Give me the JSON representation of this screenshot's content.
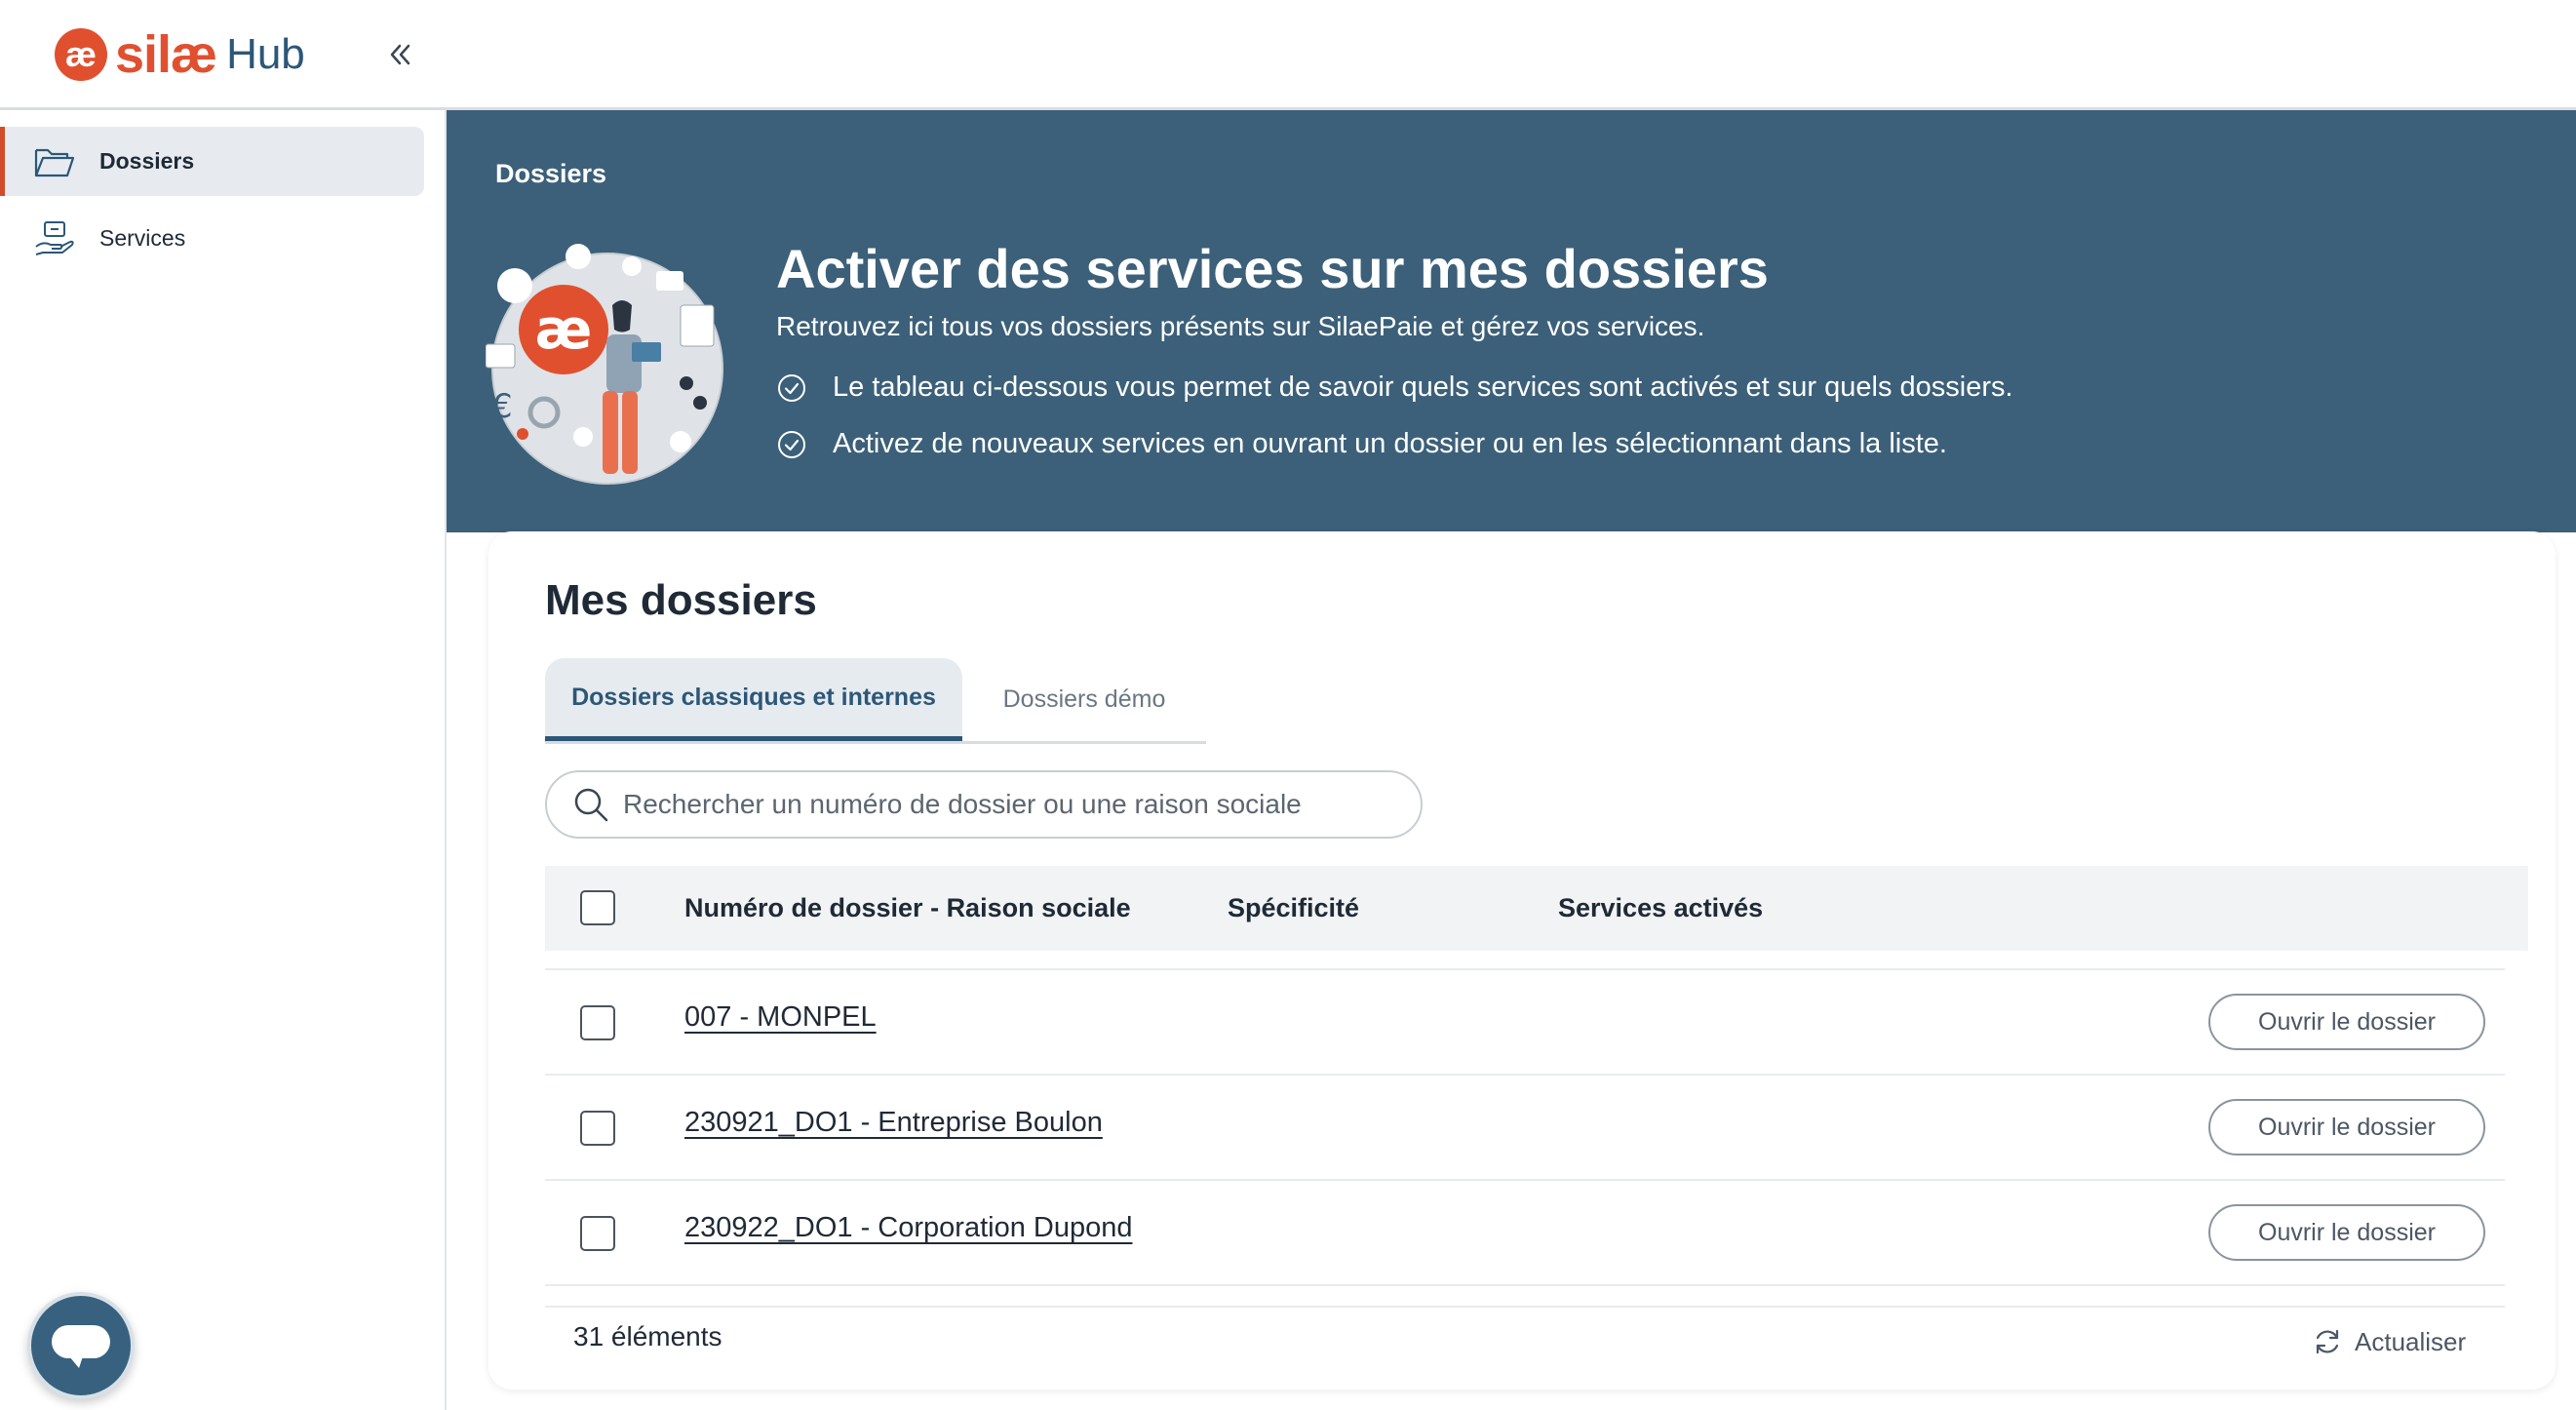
{
  "app": {
    "brand": "silæ",
    "product": "Hub",
    "logo_mark": "æ"
  },
  "sidebar": {
    "items": [
      {
        "label": "Dossiers",
        "icon": "folder-open-icon",
        "active": true
      },
      {
        "label": "Services",
        "icon": "hand-service-icon",
        "active": false
      }
    ]
  },
  "hero": {
    "breadcrumb": "Dossiers",
    "title": "Activer des services sur mes dossiers",
    "subtitle": "Retrouvez ici tous vos dossiers présents sur SilaePaie et gérez vos services.",
    "bullets": [
      "Le tableau ci-dessous vous permet de savoir quels services sont activés et sur quels dossiers.",
      "Activez de nouveaux services en ouvrant un dossier ou en les sélectionnant dans la liste."
    ]
  },
  "main": {
    "title": "Mes dossiers",
    "tabs": [
      {
        "label": "Dossiers classiques et internes",
        "active": true
      },
      {
        "label": "Dossiers démo",
        "active": false
      }
    ],
    "search": {
      "placeholder": "Rechercher un numéro de dossier ou une raison sociale",
      "value": ""
    },
    "table": {
      "columns": [
        "Numéro de dossier - Raison sociale",
        "Spécificité",
        "Services activés"
      ],
      "rows": [
        {
          "name": "007 - MONPEL",
          "specificite": "",
          "services": "",
          "action": "Ouvrir le dossier"
        },
        {
          "name": "230921_DO1 - Entreprise Boulon",
          "specificite": "",
          "services": "",
          "action": "Ouvrir le dossier"
        },
        {
          "name": "230922_DO1 - Corporation Dupond",
          "specificite": "",
          "services": "",
          "action": "Ouvrir le dossier"
        }
      ]
    },
    "footer": {
      "count": "31 éléments",
      "refresh_label": "Actualiser"
    }
  },
  "colors": {
    "brand_orange": "#e0502f",
    "hero_blue": "#3c6079",
    "accent_blue": "#2c5777"
  }
}
